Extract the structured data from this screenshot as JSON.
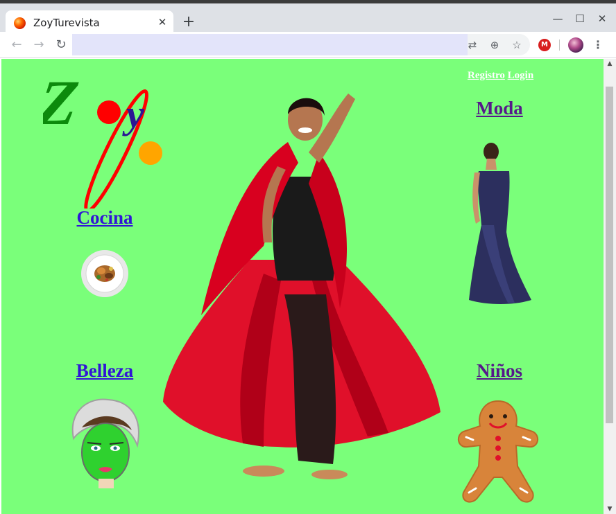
{
  "browser": {
    "tab_title": "ZoyTurevista",
    "tab_close": "✕",
    "new_tab": "+",
    "window_buttons": {
      "minimize": "—",
      "maximize": "☐",
      "close": "✕"
    },
    "nav": {
      "back": "←",
      "forward": "→",
      "reload": "↻"
    },
    "address_value": "",
    "omnibox_icons": {
      "translate": "⇄",
      "zoom": "⊕",
      "bookmark": "☆"
    },
    "extension_label": "M",
    "menu": "⋮"
  },
  "page": {
    "background": "#7aff7a",
    "logo": {
      "letters": [
        "Z",
        "o",
        "y"
      ],
      "colors": {
        "z": "#0c8a0c",
        "o": "#ff0000",
        "y": "#2a1694",
        "orbit": "#ff0000",
        "planet": "#ffa500"
      }
    },
    "auth": {
      "register": "Registro",
      "login": "Login"
    },
    "sections": {
      "cocina": "Cocina",
      "moda": "Moda",
      "belleza": "Belleza",
      "ninos": "Niños"
    },
    "link_colors": {
      "unvisited": "#3015d6",
      "visited": "#56198a"
    }
  },
  "scrollbar": {
    "up": "▲",
    "down": "▼"
  }
}
